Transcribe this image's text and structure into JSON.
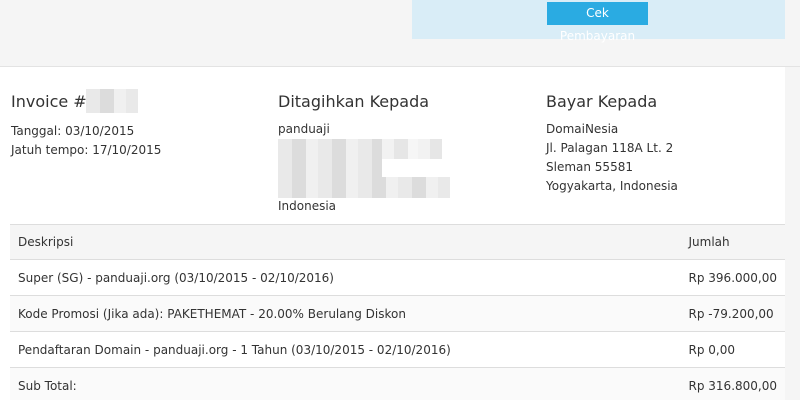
{
  "header": {
    "pay_button_label": "Cek Pembayaran"
  },
  "invoice": {
    "title": "Invoice #",
    "date_line": "Tanggal: 03/10/2015",
    "due_line": "Jatuh tempo: 17/10/2015"
  },
  "billed_to": {
    "title": "Ditagihkan Kepada",
    "name": "panduaji",
    "country": "Indonesia"
  },
  "pay_to": {
    "title": "Bayar Kepada",
    "lines": [
      "DomaiNesia",
      "Jl. Palagan 118A Lt. 2",
      "Sleman 55581",
      "Yogyakarta, Indonesia"
    ]
  },
  "table": {
    "headers": {
      "description": "Deskripsi",
      "amount": "Jumlah"
    },
    "rows": [
      {
        "description": "Super (SG) - panduaji.org (03/10/2015 - 02/10/2016)",
        "amount": "Rp 396.000,00"
      },
      {
        "description": "Kode Promosi (Jika ada): PAKETHEMAT - 20.00% Berulang Diskon",
        "amount": "Rp -79.200,00"
      },
      {
        "description": "Pendaftaran Domain - panduaji.org - 1 Tahun (03/10/2015 - 02/10/2016)",
        "amount": "Rp 0,00"
      }
    ],
    "subtotal": {
      "label": "Sub Total:",
      "amount": "Rp 316.800,00"
    }
  }
}
